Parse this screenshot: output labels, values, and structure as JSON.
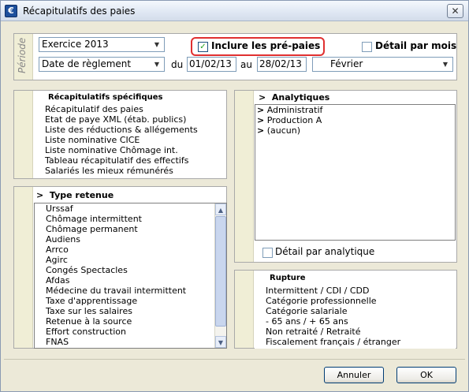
{
  "window": {
    "title": "Récapitulatifs des paies",
    "close_glyph": "✕",
    "app_icon_glyph": "€"
  },
  "period": {
    "label": "Période",
    "exercise": "Exercice 2013",
    "date_type": "Date de règlement",
    "du_label": "du",
    "du_value": "01/02/13",
    "au_label": "au",
    "au_value": "28/02/13",
    "month": "Février",
    "include_prepaid_label": "Inclure les pré-paies",
    "include_prepaid_checked": true,
    "detail_per_month_label": "Détail par mois",
    "detail_per_month_checked": false
  },
  "specific": {
    "title": "Récapitulatifs spécifiques",
    "items": [
      "Récapitulatif des paies",
      "Etat de paye XML (étab. publics)",
      "Liste des réductions & allégements",
      "Liste nominative CICE",
      "Liste nominative Chômage int.",
      "Tableau récapitulatif des effectifs",
      "Salariés les mieux rémunérés"
    ]
  },
  "retenue": {
    "title": "Type retenue",
    "items": [
      "Urssaf",
      "Chômage intermittent",
      "Chômage permanent",
      "Audiens",
      "Arrco",
      "Agirc",
      "Congés Spectacles",
      "Afdas",
      "Médecine du travail intermittent",
      "Taxe d'apprentissage",
      "Taxe sur les salaires",
      "Retenue à la source",
      "Effort construction",
      "FNAS"
    ]
  },
  "analytics": {
    "title": "Analytiques",
    "items": [
      "Administratif",
      "Production A",
      "(aucun)"
    ],
    "detail_label": "Détail par analytique",
    "detail_checked": false
  },
  "rupture": {
    "title": "Rupture",
    "items": [
      "Intermittent / CDI / CDD",
      "Catégorie professionnelle",
      "Catégorie salariale",
      "- 65 ans / + 65 ans",
      "Non retraité / Retraité",
      "Fiscalement français / étranger"
    ]
  },
  "buttons": {
    "cancel": "Annuler",
    "ok": "OK"
  },
  "icons": {
    "expand": ">",
    "dropdown": "▼",
    "check": "✓",
    "scroll_up": "▲",
    "scroll_down": "▼"
  }
}
